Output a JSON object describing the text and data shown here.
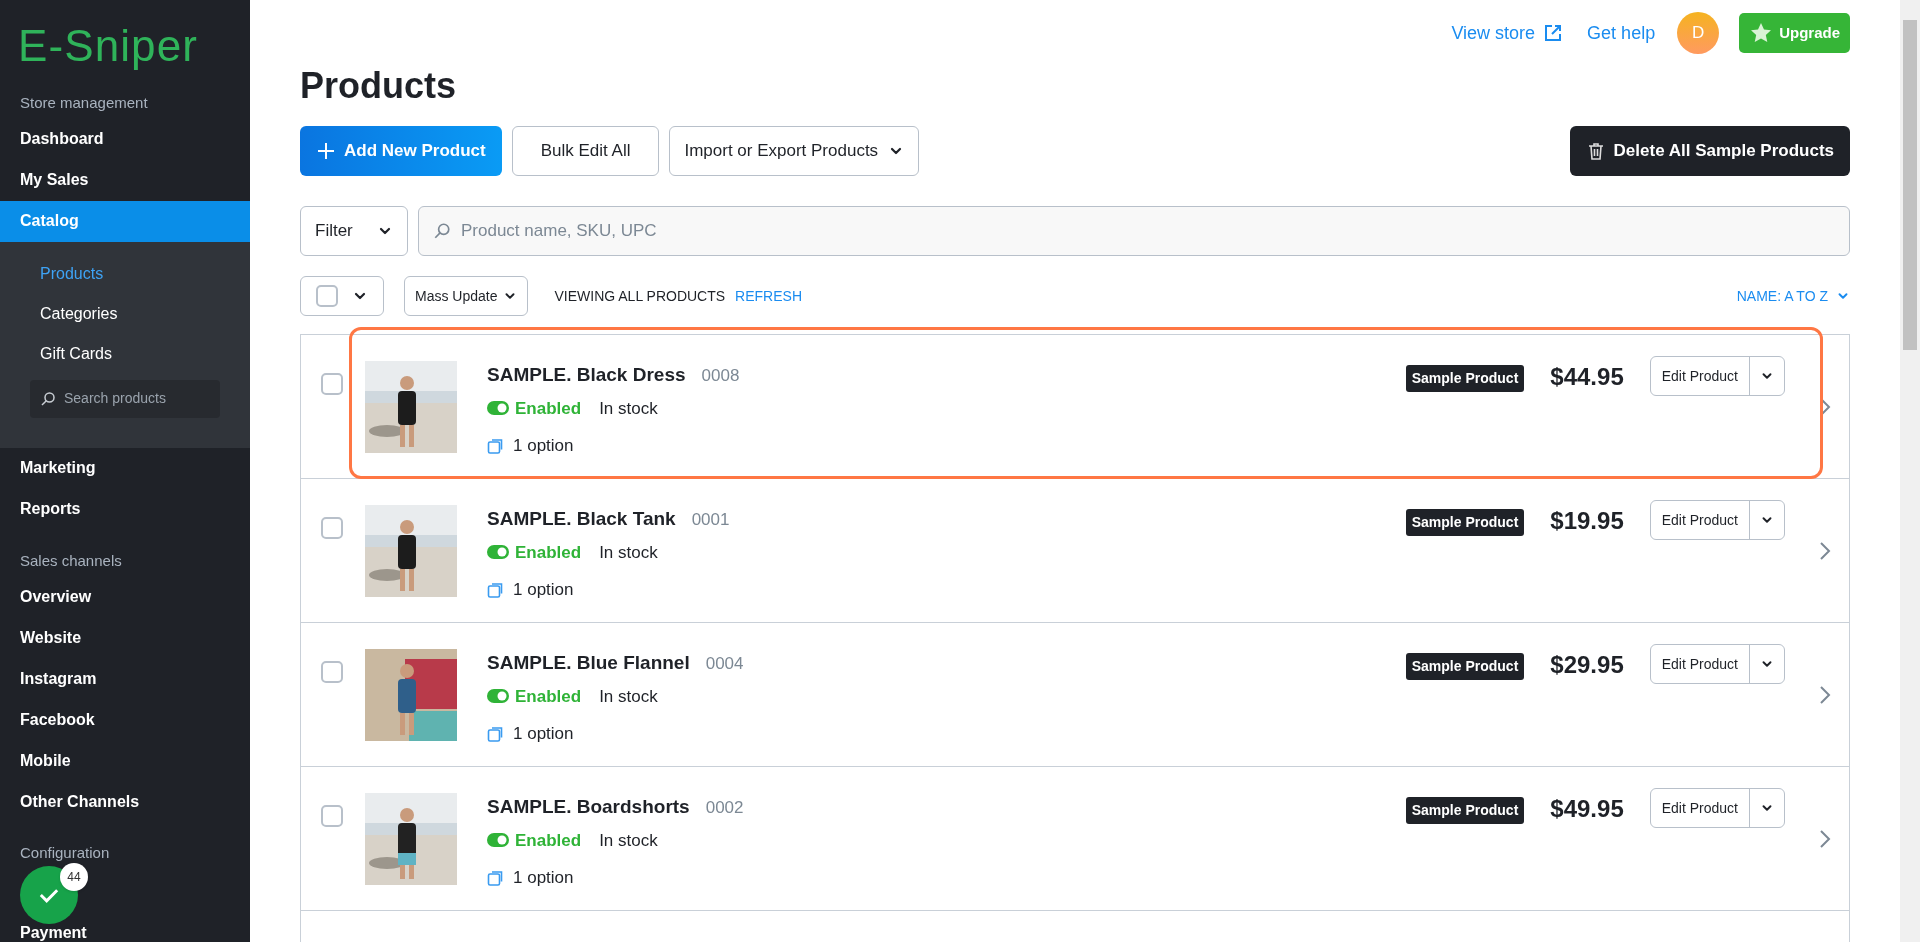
{
  "sidebar": {
    "logo": "E-Sniper",
    "sections": [
      {
        "heading": "Store management",
        "items": [
          {
            "label": "Dashboard",
            "selected": false
          },
          {
            "label": "My Sales",
            "selected": false
          },
          {
            "label": "Catalog",
            "selected": true,
            "expanded": true,
            "children": [
              {
                "label": "Products",
                "selected": true
              },
              {
                "label": "Categories",
                "selected": false
              },
              {
                "label": "Gift Cards",
                "selected": false
              }
            ],
            "search": {
              "placeholder": "Search products"
            }
          },
          {
            "label": "Marketing",
            "selected": false
          },
          {
            "label": "Reports",
            "selected": false
          }
        ]
      },
      {
        "heading": "Sales channels",
        "items": [
          {
            "label": "Overview",
            "selected": false
          },
          {
            "label": "Website",
            "selected": false
          },
          {
            "label": "Instagram",
            "selected": false
          },
          {
            "label": "Facebook",
            "selected": false
          },
          {
            "label": "Mobile",
            "selected": false
          },
          {
            "label": "Other Channels",
            "selected": false
          }
        ]
      },
      {
        "heading": "Configuration",
        "items": [
          {
            "label": "Payment",
            "selected": false
          }
        ]
      }
    ]
  },
  "floating_button": {
    "badge": "44"
  },
  "topbar": {
    "view_store": "View store",
    "get_help": "Get help",
    "avatar": "D",
    "upgrade": "Upgrade"
  },
  "title": "Products",
  "actions": {
    "add": "Add New Product",
    "bulk": "Bulk Edit All",
    "import": "Import or Export Products",
    "delete": "Delete All Sample Products"
  },
  "filter": {
    "label": "Filter",
    "search_placeholder": "Product name, SKU, UPC"
  },
  "list_controls": {
    "select_all_checked": false,
    "mass_update": "Mass Update",
    "viewing": "VIEWING ALL PRODUCTS",
    "refresh": "REFRESH",
    "sort": "NAME: A TO Z"
  },
  "products": [
    {
      "name": "SAMPLE. Black Dress",
      "sku": "0008",
      "status": "Enabled",
      "enabled": true,
      "stock": "In stock",
      "options": "1 option",
      "badge": "Sample Product",
      "price": "$44.95",
      "action": "Edit Product",
      "checked": false,
      "highlighted": true
    },
    {
      "name": "SAMPLE. Black Tank",
      "sku": "0001",
      "status": "Enabled",
      "enabled": true,
      "stock": "In stock",
      "options": "1 option",
      "badge": "Sample Product",
      "price": "$19.95",
      "action": "Edit Product",
      "checked": false,
      "highlighted": false
    },
    {
      "name": "SAMPLE. Blue Flannel",
      "sku": "0004",
      "status": "Enabled",
      "enabled": true,
      "stock": "In stock",
      "options": "1 option",
      "badge": "Sample Product",
      "price": "$29.95",
      "action": "Edit Product",
      "checked": false,
      "highlighted": false
    },
    {
      "name": "SAMPLE. Boardshorts",
      "sku": "0002",
      "status": "Enabled",
      "enabled": true,
      "stock": "In stock",
      "options": "1 option",
      "badge": "Sample Product",
      "price": "$49.95",
      "action": "Edit Product",
      "checked": false,
      "highlighted": false
    }
  ]
}
